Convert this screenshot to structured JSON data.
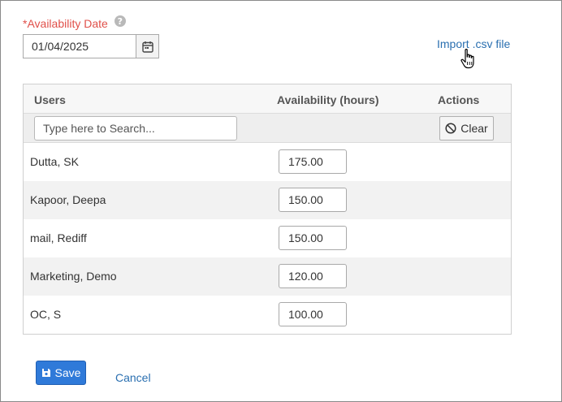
{
  "form": {
    "date_label": "*Availability Date",
    "help_icon": "?",
    "date_value": "01/04/2025",
    "import_label": "Import .csv file"
  },
  "grid": {
    "headers": {
      "users": "Users",
      "availability": "Availability (hours)",
      "actions": "Actions"
    },
    "search_placeholder": "Type here to Search...",
    "clear_label": "Clear",
    "rows": [
      {
        "name": "Dutta, SK",
        "hours": "175.00"
      },
      {
        "name": "Kapoor, Deepa",
        "hours": "150.00"
      },
      {
        "name": "mail, Rediff",
        "hours": "150.00"
      },
      {
        "name": "Marketing, Demo",
        "hours": "120.00"
      },
      {
        "name": "OC, S",
        "hours": "100.00"
      }
    ]
  },
  "footer": {
    "save_label": "Save",
    "cancel_label": "Cancel"
  },
  "icons": {
    "help": "question-circle-icon",
    "calendar": "calendar-icon",
    "clear": "ban-icon",
    "save": "floppy-disk-icon",
    "cursor": "hand-pointer-cursor"
  },
  "colors": {
    "required_label": "#e0504a",
    "link": "#2a6fb0",
    "primary_button": "#2f7ad9"
  }
}
